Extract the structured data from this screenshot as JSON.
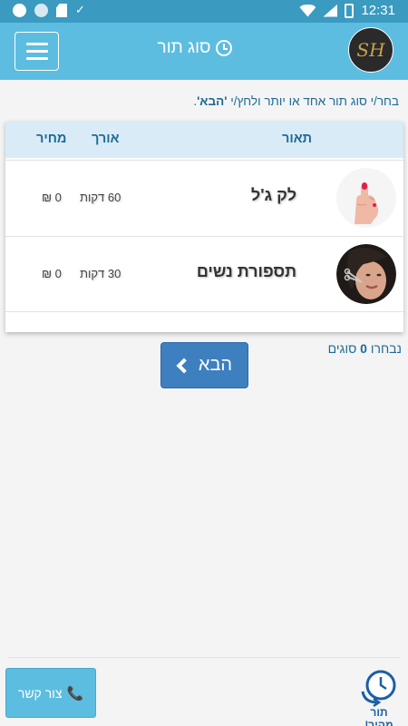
{
  "status_bar": {
    "time": "12:31"
  },
  "header": {
    "title": "סוג תור",
    "logo_text": "SH"
  },
  "instruction": {
    "text": "בחר/י סוג תור אחד או יותר ולחץ/י ",
    "emphasis": "'הבא'",
    "end": "."
  },
  "table": {
    "headers": {
      "description": "תאור",
      "length": "אורך",
      "price": "מחיר"
    },
    "rows": [
      {
        "name": "לק ג'ל",
        "length": "60 דקות",
        "price": "0 ₪",
        "image_icon": "nail-polish-hand"
      },
      {
        "name": "תספורת נשים",
        "length": "30 דקות",
        "price": "0 ₪",
        "image_icon": "woman-haircut"
      }
    ]
  },
  "next_button": {
    "label": "הבא"
  },
  "selection": {
    "prefix": "נבחרו ",
    "count": "0",
    "suffix": " סוגים"
  },
  "footer": {
    "contact_label": "צור קשר",
    "quick_label": "תור מהיר!"
  },
  "colors": {
    "primary": "#5cbde0",
    "status_bar": "#3a9ac0",
    "button": "#3d7fbf",
    "text_accent": "#1e6a93"
  }
}
